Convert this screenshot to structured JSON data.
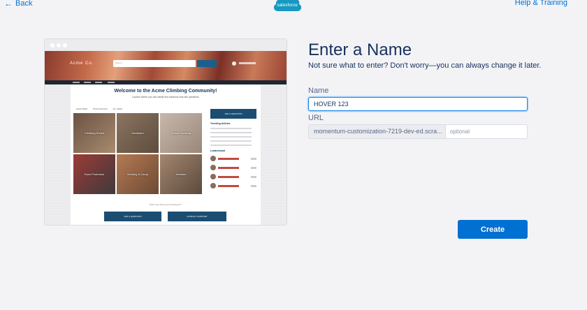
{
  "nav": {
    "back_label": "Back",
    "help_label": "Help & Training",
    "logo_text": "salesforce"
  },
  "preview": {
    "brand": "Acme Co.",
    "search_placeholder": "Search...",
    "page_title": "Welcome to the Acme Climbing Community!",
    "page_subtitle": "A place where you can easily find solutions and ask questions",
    "tabs": [
      "FEATURED",
      "DISCUSSIONS",
      "MY FEED"
    ],
    "tiles": [
      "Climbing Shoes",
      "Hardware",
      "Indoor Climbing",
      "Rock Protection",
      "Working & Camp",
      "Helmets"
    ],
    "ask_button": "ASK A QUESTION",
    "trending_title": "Trending Articles",
    "leaderboard_title": "Leaderboard",
    "bottom_prompt": "Didn't see what you're looking for?",
    "bottom_buttons": [
      "ASK A QUESTION",
      "CONTACT SUPPORT"
    ]
  },
  "form": {
    "title": "Enter a Name",
    "subtitle": "Not sure what to enter? Don't worry—you can always change it later.",
    "name_label": "Name",
    "name_value": "HOVER 123",
    "url_label": "URL",
    "url_prefix": "momentum-customization-7219-dev-ed.scra...",
    "url_placeholder": "optional",
    "create_label": "Create"
  },
  "colors": {
    "accent": "#0070d2",
    "title": "#16325c",
    "background": "#f3f3f6"
  }
}
